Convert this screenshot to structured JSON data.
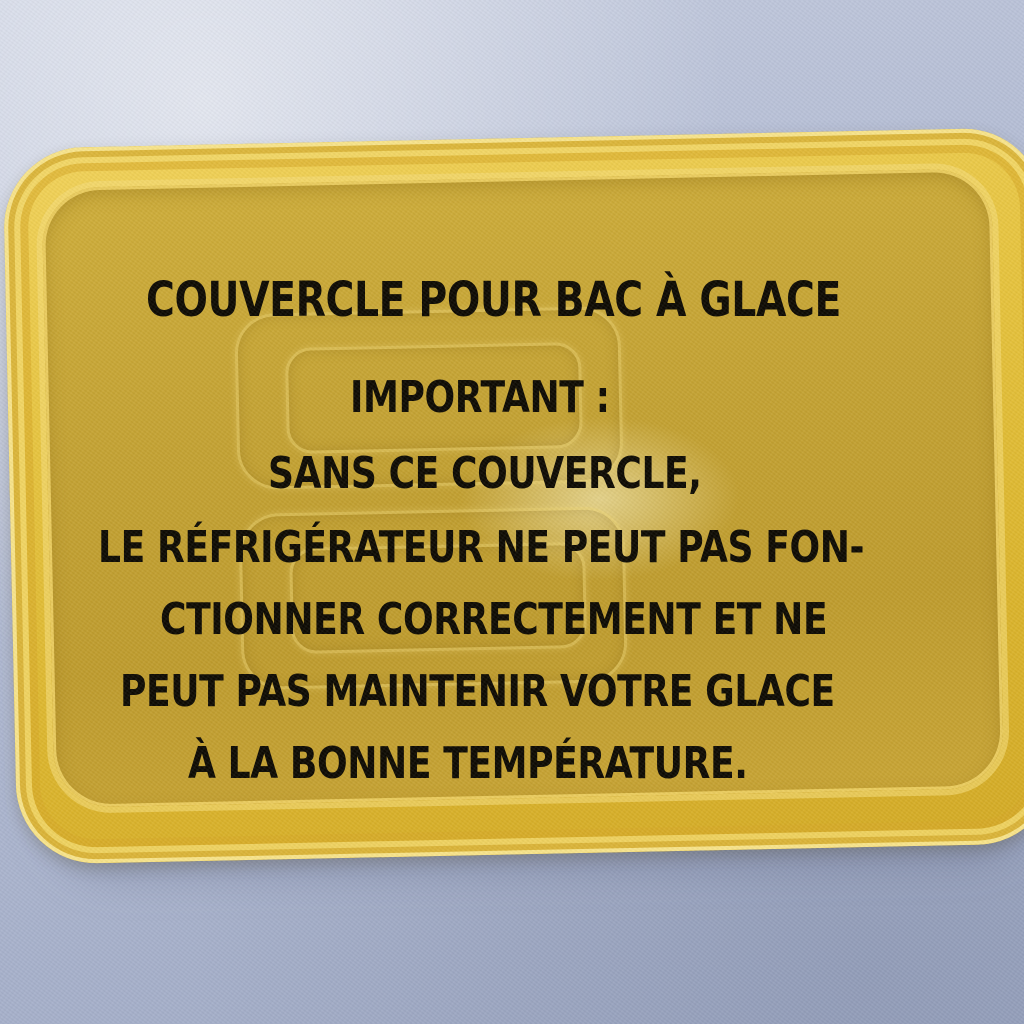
{
  "lid": {
    "color_primary": "#e7c43e",
    "color_inner": "#c4a232",
    "background_color": "#b3bcd4"
  },
  "label": {
    "title": "COUVERCLE POUR BAC À GLACE",
    "lines": [
      "IMPORTANT :",
      "SANS CE COUVERCLE,",
      "LE RÉFRIGÉRATEUR NE PEUT PAS FON-",
      "CTIONNER CORRECTEMENT ET NE",
      "PEUT PAS MAINTENIR VOTRE GLACE",
      "À LA BONNE TEMPÉRATURE."
    ]
  }
}
